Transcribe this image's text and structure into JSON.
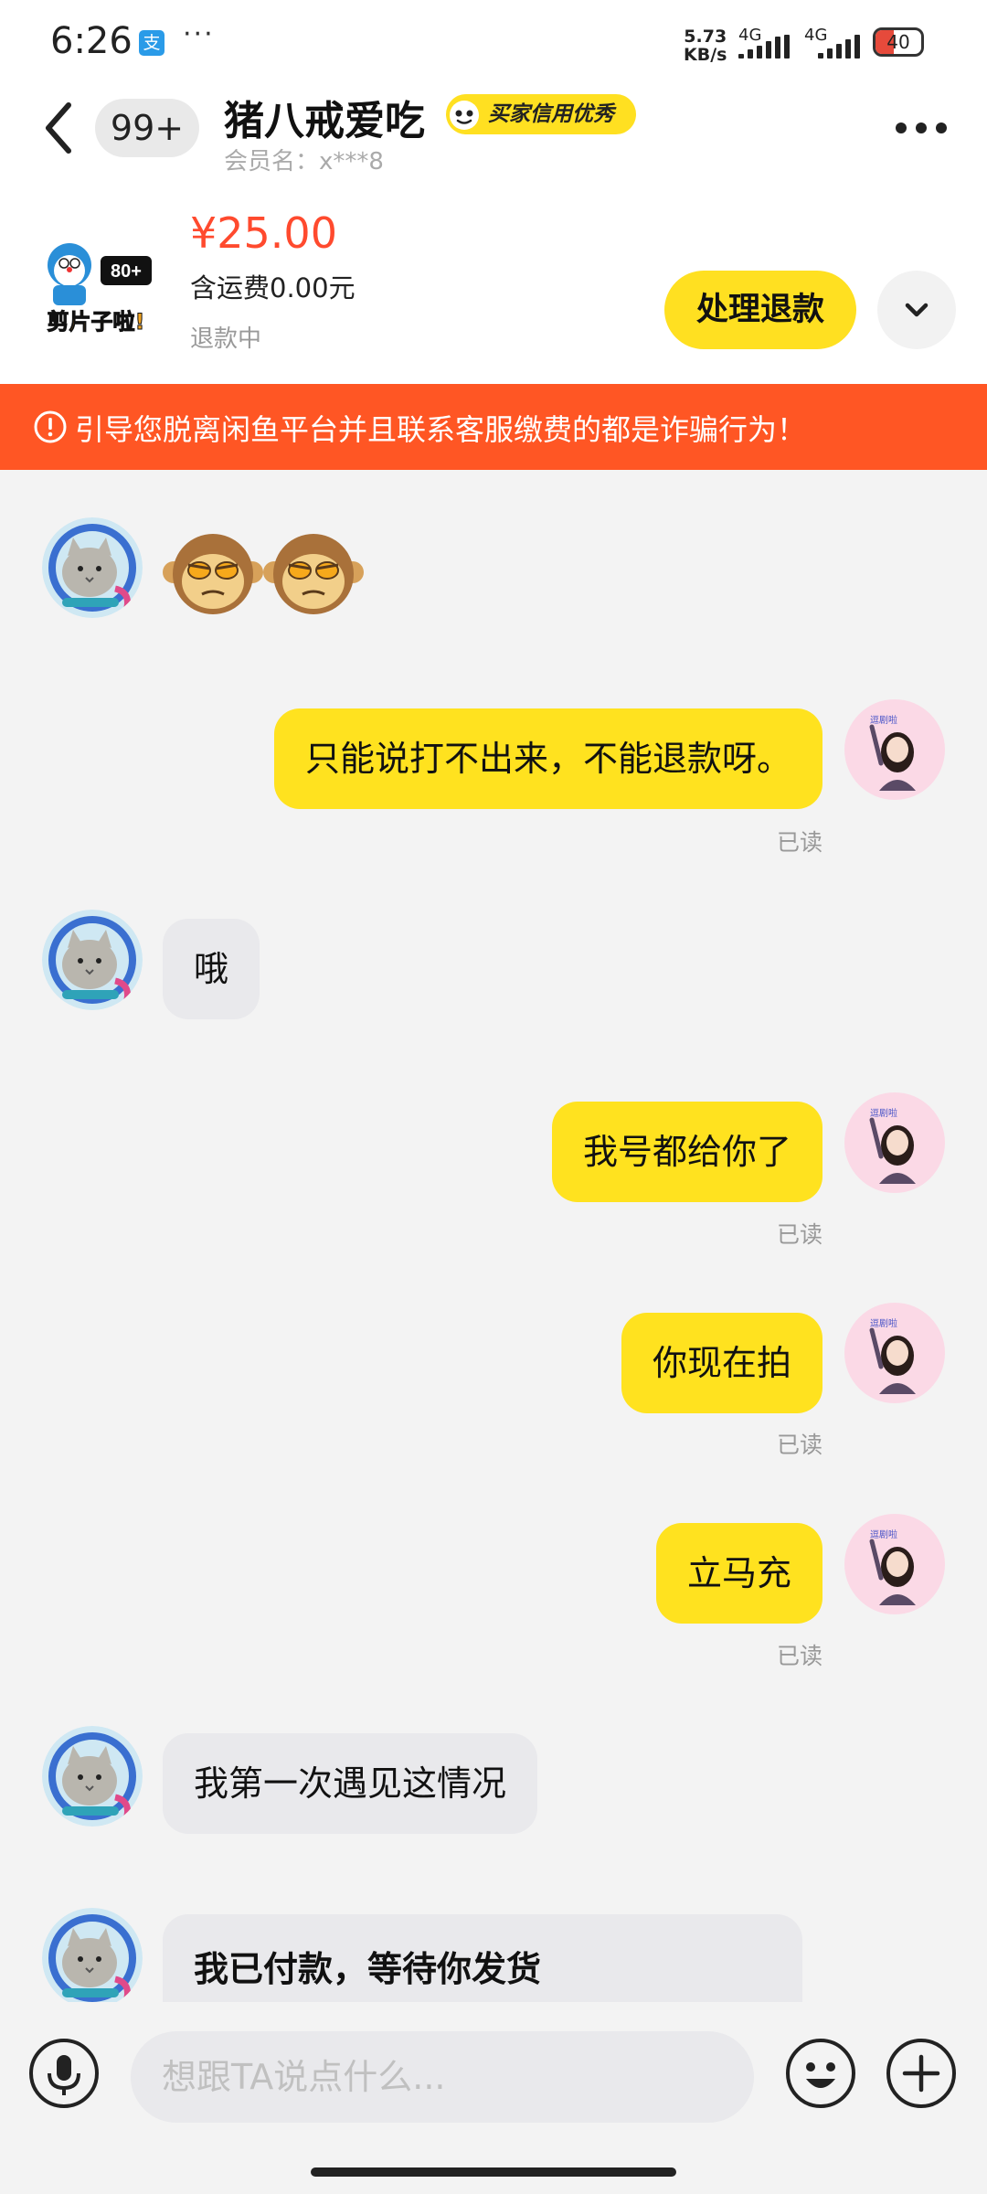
{
  "status_bar": {
    "time": "6:26",
    "alipay_glyph": "支",
    "menu_dots": "···",
    "net_speed_value": "5.73",
    "net_speed_unit": "KB/s",
    "signal_1_label": "4G",
    "signal_2_label": "4G",
    "battery_level": "40",
    "battery_color": "#e64a3b"
  },
  "header": {
    "unread_count": "99+",
    "title": "猪八戒爱吃",
    "credit_badge": "买家信用优秀",
    "member_name": "会员名：x***8"
  },
  "product": {
    "thumb_badge": "80+",
    "thumb_caption": "剪片子啦!",
    "price": "¥25.00",
    "shipping": "含运费0.00元",
    "status": "退款中",
    "action_button": "处理退款"
  },
  "warning": {
    "text": "引导您脱离闲鱼平台并且联系客服缴费的都是诈骗行为！",
    "icon": "exclamation-circle-icon"
  },
  "messages": [
    {
      "sender": "other",
      "type": "emoji",
      "content": "monkey-face-icon x2"
    },
    {
      "sender": "me",
      "text": "只能说打不出来，不能退款呀。",
      "status": "已读"
    },
    {
      "sender": "other",
      "text": "哦"
    },
    {
      "sender": "me",
      "text": "我号都给你了",
      "status": "已读"
    },
    {
      "sender": "me",
      "text": "你现在拍",
      "status": "已读"
    },
    {
      "sender": "me",
      "text": "立马充",
      "status": "已读"
    },
    {
      "sender": "other",
      "text": "我第一次遇见这情况"
    },
    {
      "sender": "other",
      "text": "我已付款，等待你发货"
    }
  ],
  "my_avatar_caption": "逗剧啦",
  "input": {
    "placeholder": "想跟TA说点什么..."
  },
  "colors": {
    "accent_yellow": "#ffe21f",
    "warning_orange": "#ff5624",
    "price_red": "#ff4a2e"
  }
}
